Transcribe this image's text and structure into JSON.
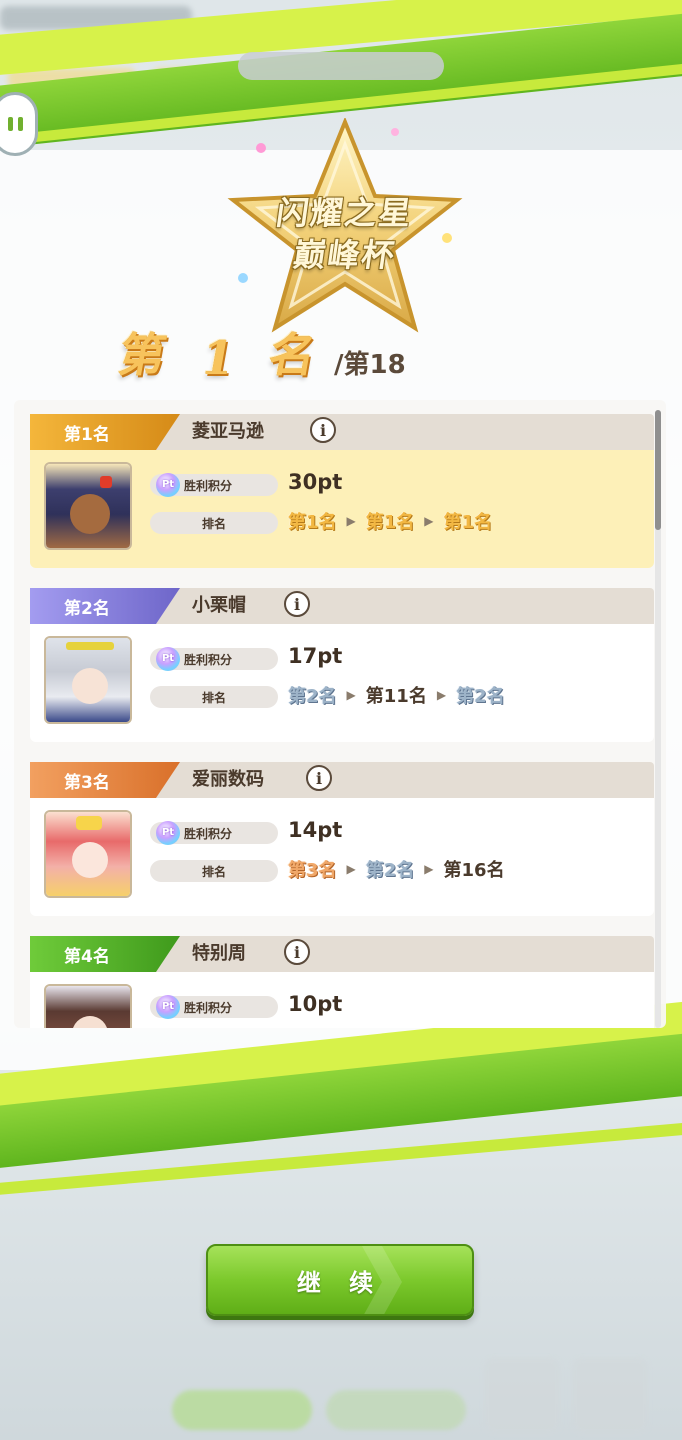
{
  "header": {
    "title": "闪耀之星",
    "subtitle": "巅峰杯"
  },
  "result": {
    "rank_prefix": "第",
    "rank_number": "1",
    "rank_suffix": "名",
    "total": "/第18"
  },
  "labels": {
    "points_label": "胜利积分",
    "rank_label": "排名",
    "pt_icon_text": "Pt",
    "info_glyph": "i"
  },
  "entries": [
    {
      "rank": "第1名",
      "name": "菱亚马逊",
      "points": "30pt",
      "history": [
        "第1名",
        "第1名",
        "第1名"
      ],
      "tab_color": "#e6a12c",
      "highlight": true
    },
    {
      "rank": "第2名",
      "name": "小栗帽",
      "points": "17pt",
      "history": [
        "第2名",
        "第11名",
        "第2名"
      ],
      "tab_color": "#8b84d8",
      "highlight": false
    },
    {
      "rank": "第3名",
      "name": "爱丽数码",
      "points": "14pt",
      "history": [
        "第3名",
        "第2名",
        "第16名"
      ],
      "tab_color": "#e98a3b",
      "highlight": false
    },
    {
      "rank": "第4名",
      "name": "特别周",
      "points": "10pt",
      "tab_color": "#58b52a",
      "highlight": false
    }
  ],
  "buttons": {
    "continue": "继 续"
  },
  "colors": {
    "stripe_green": "#7cc92c",
    "stripe_lime": "#d4f03a",
    "continue_green": "#7cc92c"
  }
}
